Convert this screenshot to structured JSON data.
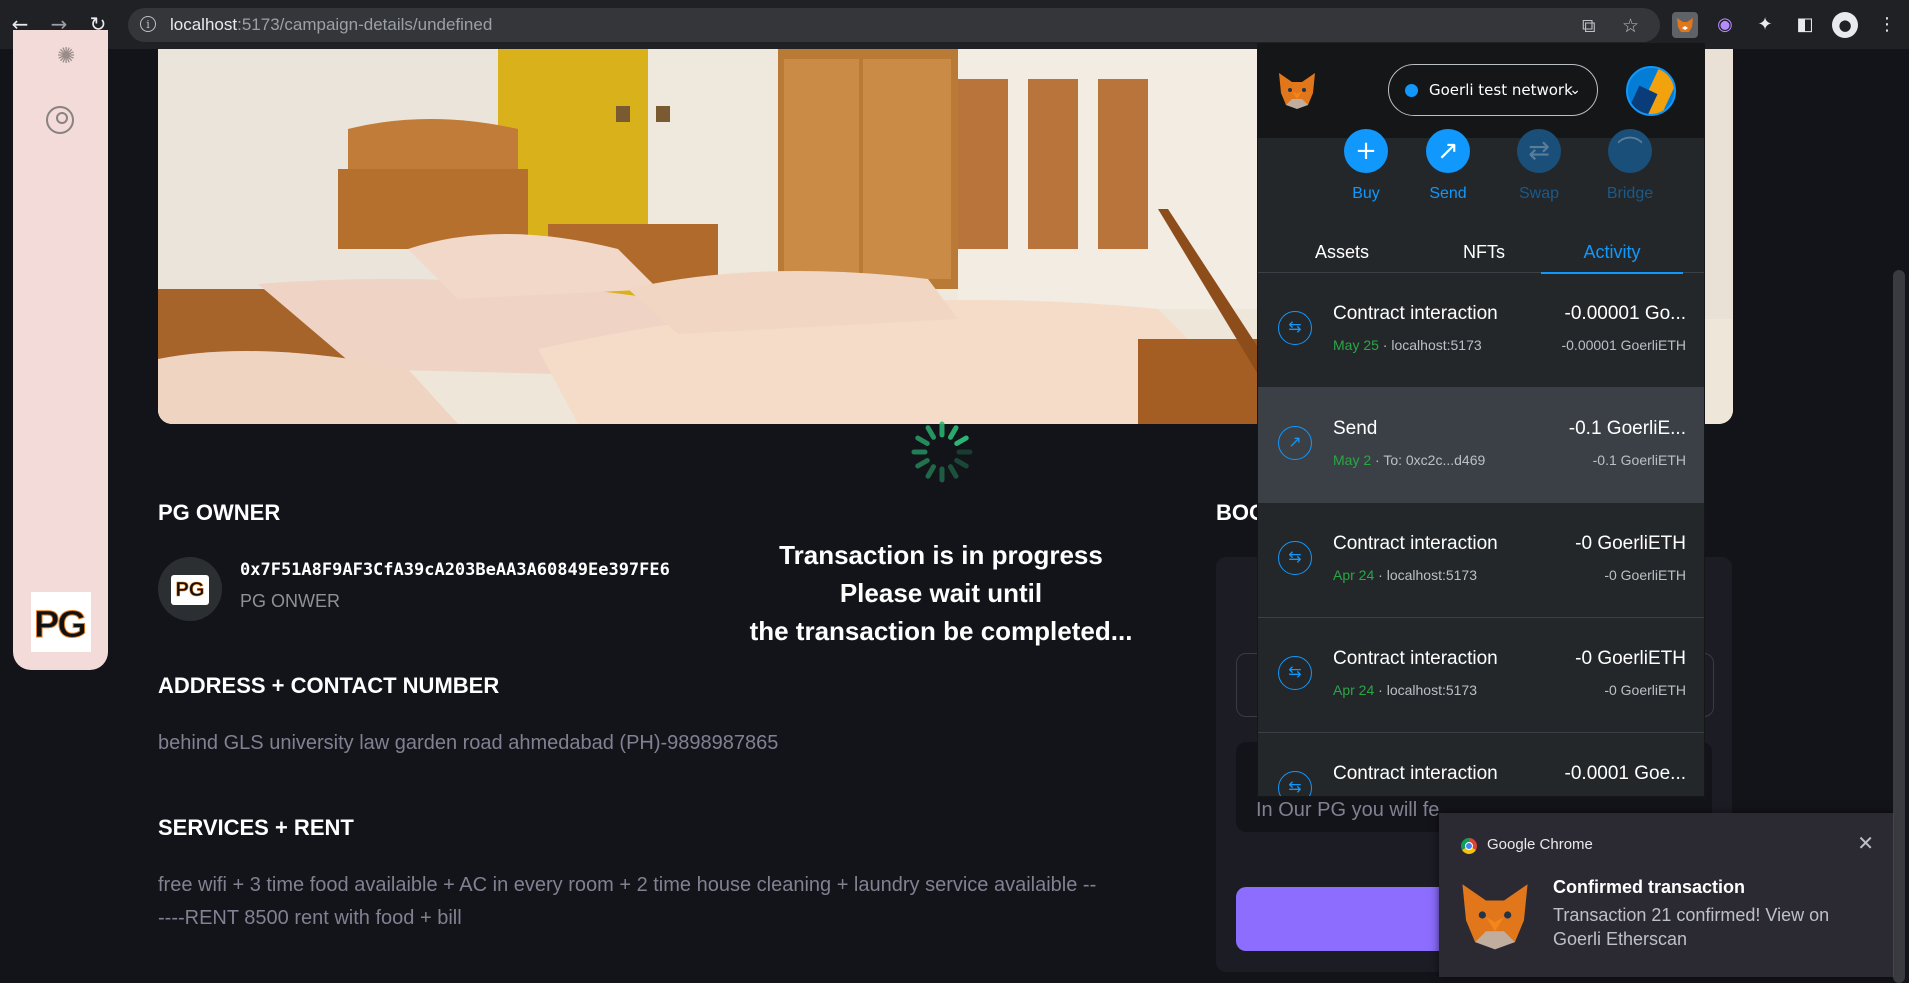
{
  "browser": {
    "url_host": "localhost",
    "url_rest": ":5173/campaign-details/undefined"
  },
  "page": {
    "owner_heading": "PG OWNER",
    "owner_address": "0x7F51A8F9AF3CfA39cA203BeAA3A60849Ee397FE6",
    "owner_role": "PG ONWER",
    "owner_avatar_text": "PG",
    "logo_text": "PG",
    "address_heading": "ADDRESS + CONTACT NUMBER",
    "address_text": "behind GLS university law garden road ahmedabad (PH)-9898987865",
    "services_heading": "SERVICES + RENT",
    "services_line1": "free wifi + 3 time food availaible + AC in every room + 2 time house cleaning + laundry service availaible --",
    "services_line2": "----RENT 8500 rent with food + bill",
    "right_heading": "BOO",
    "right_box_text": "In Our PG you will fe",
    "loading_line1": "Transaction is in progress",
    "loading_line2": "Please wait until",
    "loading_line3": "the transaction be completed..."
  },
  "metamask": {
    "network": "Goerli test network",
    "actions": [
      {
        "label": "Buy",
        "icon": "plus-icon"
      },
      {
        "label": "Send",
        "icon": "arrow-up-right-icon"
      },
      {
        "label": "Swap",
        "icon": "swap-icon"
      },
      {
        "label": "Bridge",
        "icon": "bridge-icon"
      }
    ],
    "tabs": [
      "Assets",
      "NFTs",
      "Activity"
    ],
    "activity": [
      {
        "title": "Contract interaction",
        "date": "May 25",
        "detail": "localhost:5173",
        "amount": "-0.00001 Go...",
        "amount_sub": "-0.00001 GoerliETH",
        "icon": "interaction-icon"
      },
      {
        "title": "Send",
        "date": "May 2",
        "detail": "To: 0xc2c...d469",
        "amount": "-0.1 GoerliE...",
        "amount_sub": "-0.1 GoerliETH",
        "icon": "send-icon"
      },
      {
        "title": "Contract interaction",
        "date": "Apr 24",
        "detail": "localhost:5173",
        "amount": "-0 GoerliETH",
        "amount_sub": "-0 GoerliETH",
        "icon": "interaction-icon"
      },
      {
        "title": "Contract interaction",
        "date": "Apr 24",
        "detail": "localhost:5173",
        "amount": "-0 GoerliETH",
        "amount_sub": "-0 GoerliETH",
        "icon": "interaction-icon"
      },
      {
        "title": "Contract interaction",
        "date": "",
        "detail": "",
        "amount": "-0.0001 Goe...",
        "amount_sub": "",
        "icon": "interaction-icon"
      }
    ]
  },
  "notification": {
    "source": "Google Chrome",
    "title": "Confirmed transaction",
    "message": "Transaction 21 confirmed! View on Goerli Etherscan"
  },
  "colors": {
    "accent_blue": "#1098fc",
    "button_purple": "#8c6dfd",
    "spinner_green": "#2bb673",
    "page_bg": "#13131a"
  }
}
